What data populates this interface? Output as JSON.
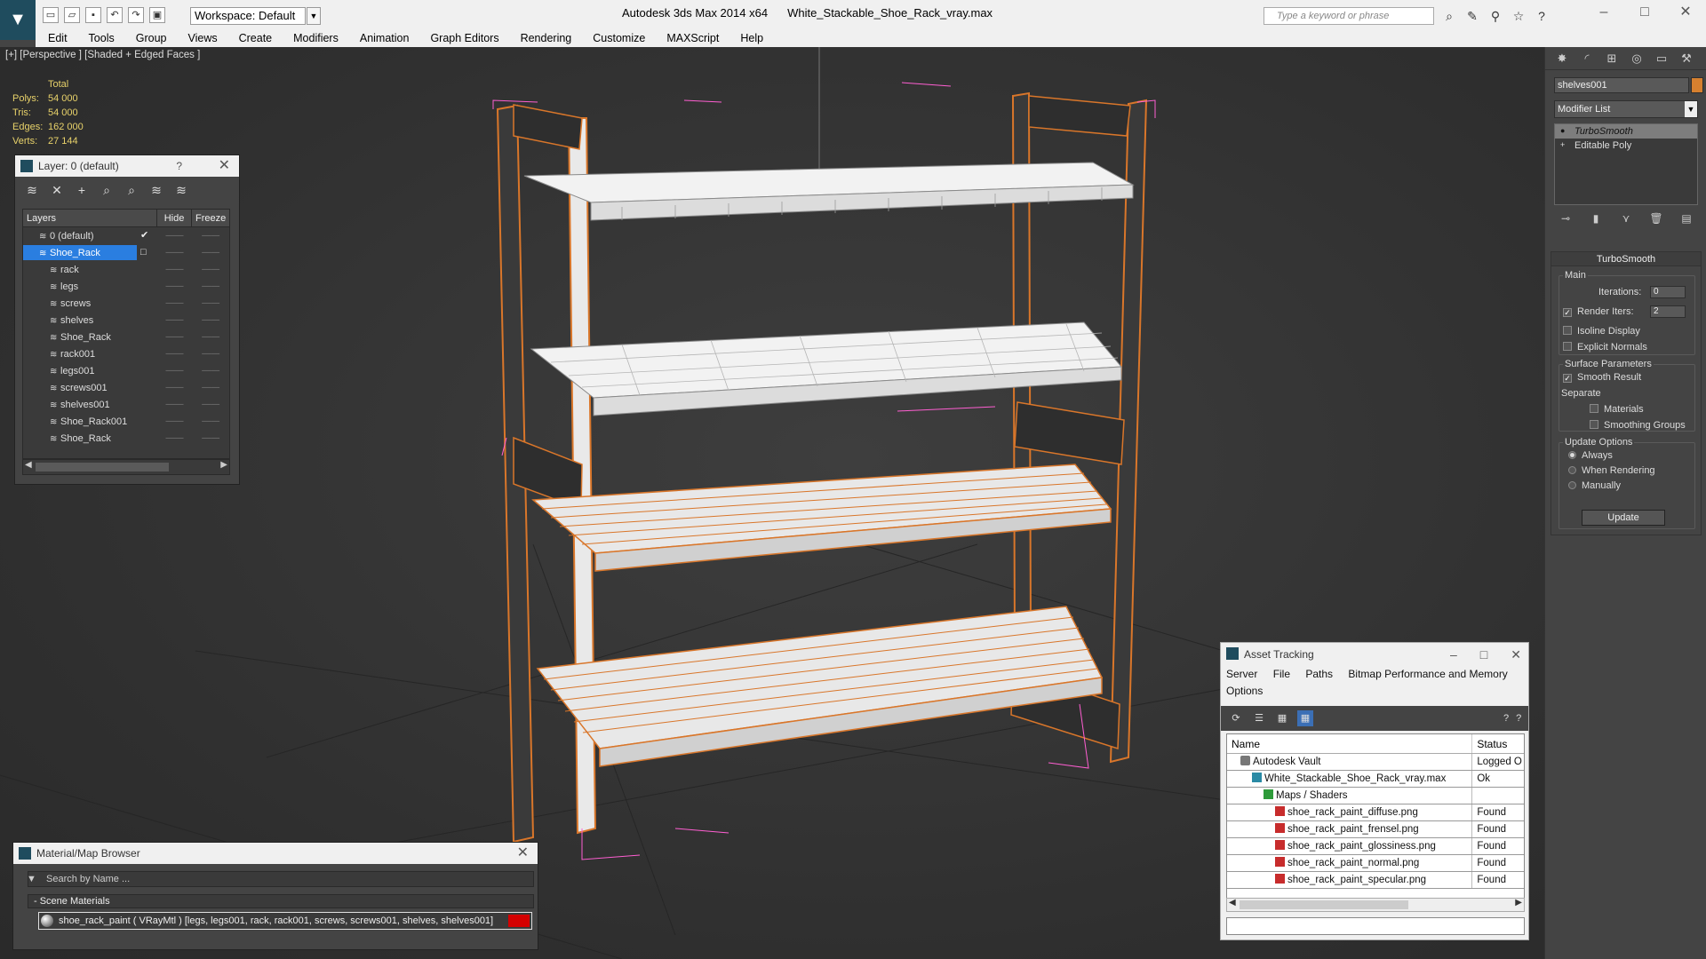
{
  "app": {
    "product": "Autodesk 3ds Max  2014 x64",
    "file": "White_Stackable_Shoe_Rack_vray.max",
    "workspace": "Workspace: Default",
    "search_placeholder": "Type a keyword or phrase"
  },
  "menu": [
    "Edit",
    "Tools",
    "Group",
    "Views",
    "Create",
    "Modifiers",
    "Animation",
    "Graph Editors",
    "Rendering",
    "Customize",
    "MAXScript",
    "Help"
  ],
  "viewport": {
    "label": "[+] [Perspective ] [Shaded + Edged Faces ]",
    "stats_header": "Total",
    "stats": [
      {
        "k": "Polys:",
        "v": "54 000"
      },
      {
        "k": "Tris:",
        "v": "54 000"
      },
      {
        "k": "Edges:",
        "v": "162 000"
      },
      {
        "k": "Verts:",
        "v": "27 144"
      }
    ],
    "colors": {
      "wire": "#d9762a",
      "shelf": "#f2f2f2",
      "selection": "#ff5fd2"
    }
  },
  "layer_dialog": {
    "title": "Layer: 0 (default)",
    "help": "?",
    "columns": {
      "layers": "Layers",
      "hide": "Hide",
      "freeze": "Freeze"
    },
    "rows": [
      {
        "name": "0 (default)",
        "level": 0,
        "current": "✔"
      },
      {
        "name": "Shoe_Rack",
        "level": 0,
        "selected": true,
        "current": "□"
      },
      {
        "name": "rack",
        "level": 1
      },
      {
        "name": "legs",
        "level": 1
      },
      {
        "name": "screws",
        "level": 1
      },
      {
        "name": "shelves",
        "level": 1
      },
      {
        "name": "Shoe_Rack",
        "level": 1
      },
      {
        "name": "rack001",
        "level": 1
      },
      {
        "name": "legs001",
        "level": 1
      },
      {
        "name": "screws001",
        "level": 1
      },
      {
        "name": "shelves001",
        "level": 1
      },
      {
        "name": "Shoe_Rack001",
        "level": 1
      },
      {
        "name": "Shoe_Rack",
        "level": 1
      }
    ]
  },
  "material_browser": {
    "title": "Material/Map Browser",
    "search_placeholder": "Search by Name ...",
    "section": "- Scene Materials",
    "item": "shoe_rack_paint  ( VRayMtl )  [legs, legs001, rack, rack001, screws, screws001, shelves, shelves001]",
    "swatch_color": "#d40000"
  },
  "asset_tracking": {
    "title": "Asset Tracking",
    "menu": [
      "Server",
      "File",
      "Paths",
      "Bitmap Performance and Memory"
    ],
    "menu2": "Options",
    "columns": {
      "name": "Name",
      "status": "Status"
    },
    "rows": [
      {
        "name": "Autodesk Vault",
        "status": "Logged O",
        "indent": 1,
        "icon": "vault"
      },
      {
        "name": "White_Stackable_Shoe_Rack_vray.max",
        "status": "Ok",
        "indent": 2,
        "icon": "max"
      },
      {
        "name": "Maps / Shaders",
        "status": "",
        "indent": 3,
        "icon": "maps"
      },
      {
        "name": "shoe_rack_paint_diffuse.png",
        "status": "Found",
        "indent": 4,
        "icon": "png"
      },
      {
        "name": "shoe_rack_paint_frensel.png",
        "status": "Found",
        "indent": 4,
        "icon": "png"
      },
      {
        "name": "shoe_rack_paint_glossiness.png",
        "status": "Found",
        "indent": 4,
        "icon": "png"
      },
      {
        "name": "shoe_rack_paint_normal.png",
        "status": "Found",
        "indent": 4,
        "icon": "png"
      },
      {
        "name": "shoe_rack_paint_specular.png",
        "status": "Found",
        "indent": 4,
        "icon": "png"
      }
    ]
  },
  "command_panel": {
    "object_name": "shelves001",
    "object_color": "#d6802f",
    "modifier_list": "Modifier List",
    "stack": [
      {
        "label": "TurboSmooth",
        "selected": true
      },
      {
        "label": "Editable Poly",
        "selected": false
      }
    ],
    "rollout_title": "TurboSmooth",
    "main_label": "Main",
    "iterations_label": "Iterations:",
    "iterations_value": "0",
    "render_iters_label": "Render Iters:",
    "render_iters_value": "2",
    "isoline_label": "Isoline Display",
    "explicit_label": "Explicit Normals",
    "surface_label": "Surface Parameters",
    "smooth_label": "Smooth Result",
    "separate_label": "Separate",
    "materials_label": "Materials",
    "smoothing_groups_label": "Smoothing Groups",
    "update_options_label": "Update Options",
    "always_label": "Always",
    "when_rendering_label": "When Rendering",
    "manually_label": "Manually",
    "update_button": "Update"
  }
}
